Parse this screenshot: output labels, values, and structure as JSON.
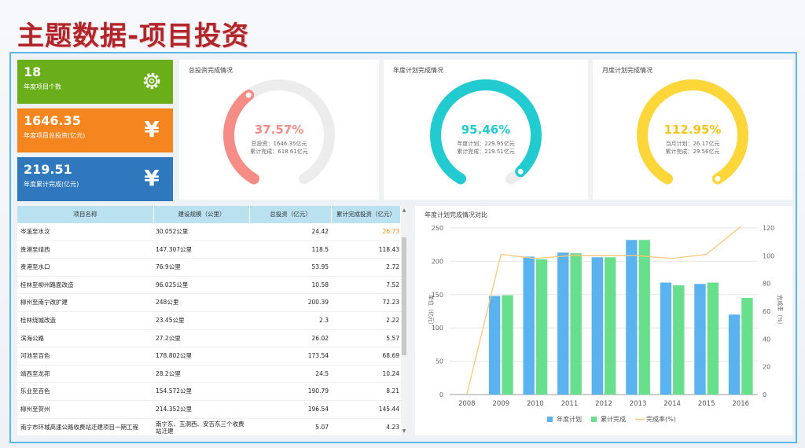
{
  "page": {
    "title": "主题数据-项目投资"
  },
  "stats": [
    {
      "value": "18",
      "label": "年度项目个数",
      "color": "#6aae1a",
      "icon": "gear-icon",
      "glyph": "⚙"
    },
    {
      "value": "1646.35",
      "label": "年度项目总投资(亿元)",
      "color": "#f5861f",
      "icon": "yuan-icon",
      "glyph": "¥"
    },
    {
      "value": "219.51",
      "label": "年度累计完成(亿元)",
      "color": "#2f78bd",
      "icon": "yuan-icon",
      "glyph": "¥"
    }
  ],
  "gauges": [
    {
      "title": "总投资完成情况",
      "percent": "37.57%",
      "fraction": 0.3757,
      "color": "#f58c86",
      "line1": "总投资：1646.35亿元",
      "line2": "累计完成：618.61亿元"
    },
    {
      "title": "年度计划完成情况",
      "percent": "95.46%",
      "fraction": 0.9546,
      "color": "#22cbd0",
      "line1": "年度计划：229.95亿元",
      "line2": "累计完成：219.51亿元"
    },
    {
      "title": "月度计划完成情况",
      "percent": "112.95%",
      "fraction": 1.0,
      "color": "#fdd63a",
      "line1": "当月计划：26.17亿元",
      "line2": "累计完成：29.56亿元"
    }
  ],
  "table": {
    "headers": [
      "项目名称",
      "建设规模（公里）",
      "总投资（亿元）",
      "累计完成投资（亿元）"
    ],
    "rows": [
      [
        "岑溪至水汶",
        "30.052公里",
        "24.42",
        "26.73"
      ],
      [
        "贵港至靖西",
        "147.307公里",
        "118.5",
        "118.43"
      ],
      [
        "贵港至水口",
        "76.9公里",
        "53.95",
        "2.72"
      ],
      [
        "桂林至柳州路面改造",
        "96.025公里",
        "10.58",
        "7.52"
      ],
      [
        "柳州至南宁改扩建",
        "248公里",
        "200.39",
        "72.23"
      ],
      [
        "桂林绕城改造",
        "23.45公里",
        "2.3",
        "2.22"
      ],
      [
        "滨海公路",
        "27.2公里",
        "26.02",
        "5.57"
      ],
      [
        "河池至百色",
        "178.802公里",
        "173.54",
        "68.69"
      ],
      [
        "靖西至龙邦",
        "28.2公里",
        "24.5",
        "10.24"
      ],
      [
        "乐业至百色",
        "154.572公里",
        "190.79",
        "8.21"
      ],
      [
        "柳州至贺州",
        "214.352公里",
        "196.54",
        "145.44"
      ],
      [
        "南宁市环城高速公路收费站迁建项目一期工程",
        "南宁东、玉洞西、安吉东三个收费站迁建",
        "5.07",
        "4.23"
      ]
    ]
  },
  "chart_data": {
    "type": "bar",
    "title": "年度计划完成情况对比",
    "categories": [
      "2008",
      "2009",
      "2010",
      "2011",
      "2012",
      "2013",
      "2014",
      "2015",
      "2016"
    ],
    "series": [
      {
        "name": "年度计划",
        "values": [
          0,
          148,
          207,
          213,
          206,
          232,
          168,
          166,
          120
        ],
        "color": "#5ab2ee"
      },
      {
        "name": "累计完成",
        "values": [
          0,
          149,
          203,
          212,
          206,
          232,
          164,
          168,
          145
        ],
        "color": "#67df8d"
      },
      {
        "name": "完成率(%)",
        "values": [
          0,
          101,
          98,
          100,
          100,
          100,
          98,
          101,
          121
        ],
        "color": "#f8c77a"
      }
    ],
    "ylabel": "单位（亿元）",
    "y2label": "完成率（%）",
    "ylim": [
      0,
      250
    ],
    "y2lim": [
      0,
      120
    ],
    "yticks": [
      0,
      50,
      100,
      150,
      200,
      250
    ],
    "y2ticks": [
      0,
      20,
      40,
      60,
      80,
      100,
      120
    ],
    "grid": true,
    "legend": "bottom"
  }
}
